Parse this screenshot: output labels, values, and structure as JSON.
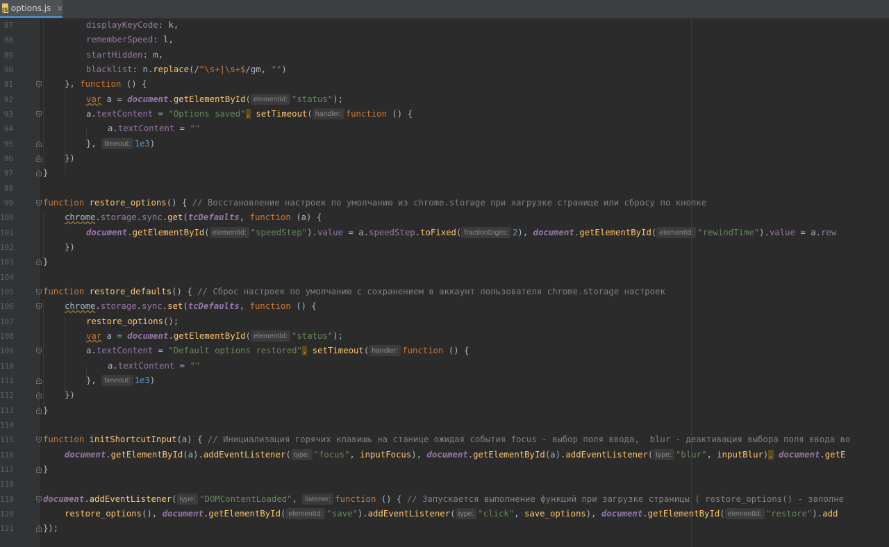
{
  "tab": {
    "filename": "options.js",
    "icon": "js-file-icon",
    "close_glyph": "×"
  },
  "hints": {
    "elementId": "elementId:",
    "handler": "handler:",
    "timeout": "timeout:",
    "fractionDigits": "fractionDigits:",
    "type": "type:",
    "listener": "listener:"
  },
  "line_numbers": [
    "87",
    "88",
    "89",
    "90",
    "91",
    "92",
    "93",
    "94",
    "95",
    "96",
    "97",
    "98",
    "99",
    "100",
    "101",
    "102",
    "103",
    "104",
    "105",
    "106",
    "107",
    "108",
    "109",
    "110",
    "111",
    "112",
    "113",
    "114",
    "115",
    "116",
    "117",
    "118",
    "119",
    "120",
    "121"
  ],
  "code": {
    "l87": [
      "displayKeyCode",
      ": k,"
    ],
    "l88": [
      "rememberSpeed",
      ": l,"
    ],
    "l89": [
      "startHidden",
      ": m,"
    ],
    "l90": [
      "blacklist",
      ": n.",
      "replace",
      "(/",
      "^\\s+|\\s+$",
      "/gm",
      ", ",
      "\"\"",
      ")"
    ],
    "l91": [
      "}, ",
      "function",
      " () {"
    ],
    "l92": [
      "var",
      " a = ",
      "document",
      ".",
      "getElementById",
      "(",
      "\"status\"",
      ");"
    ],
    "l93": [
      "a.",
      "textContent",
      " = ",
      "\"Options saved\"",
      ",",
      " ",
      "setTimeout",
      "(",
      "function",
      " () {"
    ],
    "l94": [
      "a.",
      "textContent",
      " = ",
      "\"\""
    ],
    "l95": [
      "}, ",
      "1e3",
      ")"
    ],
    "l96": [
      "})"
    ],
    "l97": [
      "}"
    ],
    "l99": [
      "function",
      " ",
      "restore_options",
      "() { ",
      "// Восстановление настроек по умолчанию из chrome.storage при хагрузке странице или сбросу по кнопке"
    ],
    "l100": [
      "chrome",
      ".",
      "storage",
      ".",
      "sync",
      ".",
      "get",
      "(",
      "tcDefaults",
      ", ",
      "function",
      " (a) {"
    ],
    "l101": [
      "document",
      ".",
      "getElementById",
      "(",
      "\"speedStep\"",
      ").",
      "value",
      " = a.",
      "speedStep",
      ".",
      "toFixed",
      "(",
      "2",
      "), ",
      "document",
      ".",
      "getElementById",
      "(",
      "\"rewindTime\"",
      ").",
      "value",
      " = a.",
      "rew"
    ],
    "l102": [
      "})"
    ],
    "l103": [
      "}"
    ],
    "l105": [
      "function",
      " ",
      "restore_defaults",
      "() { ",
      "// Сброс настроек по умолчанию с сохранением в аккаунт пользователя chrome.storage настроек"
    ],
    "l106": [
      "chrome",
      ".",
      "storage",
      ".",
      "sync",
      ".",
      "set",
      "(",
      "tcDefaults",
      ", ",
      "function",
      " () {"
    ],
    "l107": [
      "restore_options",
      "();"
    ],
    "l108": [
      "var",
      " a = ",
      "document",
      ".",
      "getElementById",
      "(",
      "\"status\"",
      ");"
    ],
    "l109": [
      "a.",
      "textContent",
      " = ",
      "\"Default options restored\"",
      ",",
      " ",
      "setTimeout",
      "(",
      "function",
      " () {"
    ],
    "l110": [
      "a.",
      "textContent",
      " = ",
      "\"\""
    ],
    "l111": [
      "}, ",
      "1e3",
      ")"
    ],
    "l112": [
      "})"
    ],
    "l113": [
      "}"
    ],
    "l115": [
      "function",
      " ",
      "initShortcutInput",
      "(a) { ",
      "// Инициализация горячих клавишь на станице ожидая события focus - выбор поля ввода,  blur - деактивация выбора поля ввода во"
    ],
    "l116": [
      "document",
      ".",
      "getElementById",
      "(a).",
      "addEventListener",
      "(",
      "\"focus\"",
      ", ",
      "inputFocus",
      "), ",
      "document",
      ".",
      "getElementById",
      "(a).",
      "addEventListener",
      "(",
      "\"blur\"",
      ", ",
      "inputBlur",
      ")",
      ",",
      " ",
      "document",
      ".",
      "getE"
    ],
    "l117": [
      "}"
    ],
    "l119": [
      "document",
      ".",
      "addEventListener",
      "(",
      "\"DOMContentLoaded\"",
      ", ",
      "function",
      " () { ",
      "// Запускается выполнение функций при загрузке страницы ( restore_options() - заполне"
    ],
    "l120": [
      "restore_options",
      "(), ",
      "document",
      ".",
      "getElementById",
      "(",
      "\"save\"",
      ").",
      "addEventListener",
      "(",
      "\"click\"",
      ", ",
      "save_options",
      "), ",
      "document",
      ".",
      "getElementById",
      "(",
      "\"restore\"",
      ").",
      "add"
    ],
    "l121": [
      "});"
    ]
  },
  "colors": {
    "background": "#2b2b2b",
    "keyword": "#cc7832",
    "function_name": "#ffc66d",
    "string": "#6a8759",
    "number": "#6897bb",
    "property": "#9876aa",
    "comment": "#808080",
    "default_text": "#a9b7c6"
  }
}
